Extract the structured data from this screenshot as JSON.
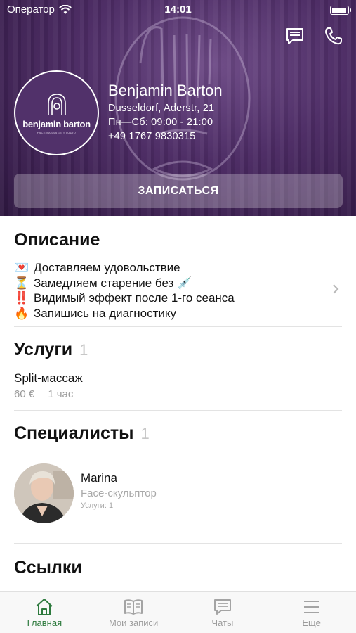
{
  "status_bar": {
    "carrier": "Оператор",
    "time": "14:01",
    "battery_level": 0.95
  },
  "business": {
    "logo_name": "benjamin barton",
    "logo_sub": "FACEMASSAGE STUDIO",
    "name": "Benjamin Barton",
    "address": "Dusseldorf, Aderstr, 21",
    "hours": "Пн—Сб: 09:00 - 21:00",
    "phone": "+49 1767 9830315",
    "book_label": "ЗАПИСАТЬСЯ"
  },
  "description": {
    "title": "Описание",
    "lines": [
      {
        "emoji": "💌",
        "text": "Доставляем удовольствие"
      },
      {
        "emoji": "⏳",
        "text": "Замедляем старение без 💉"
      },
      {
        "emoji": "‼️",
        "text": "Видимый эффект после 1-го сеанса"
      },
      {
        "emoji": "🔥",
        "text": "Запишись на диагностику"
      }
    ]
  },
  "services": {
    "title": "Услуги",
    "count": "1",
    "items": [
      {
        "name": "Split-массаж",
        "price": "60 €",
        "duration": "1 час"
      }
    ]
  },
  "specialists": {
    "title": "Специалисты",
    "count": "1",
    "items": [
      {
        "name": "Marina",
        "role": "Face-скульптор",
        "services": "Услуги: 1"
      }
    ]
  },
  "links": {
    "title": "Ссылки"
  },
  "tabs": [
    {
      "label": "Главная",
      "icon": "home-icon"
    },
    {
      "label": "Мои записи",
      "icon": "book-icon"
    },
    {
      "label": "Чаты",
      "icon": "chat-icon"
    },
    {
      "label": "Еще",
      "icon": "menu-icon"
    }
  ],
  "colors": {
    "accent": "#2d7a3d",
    "hero": "#4b2a63",
    "muted": "#9b9b9b"
  }
}
